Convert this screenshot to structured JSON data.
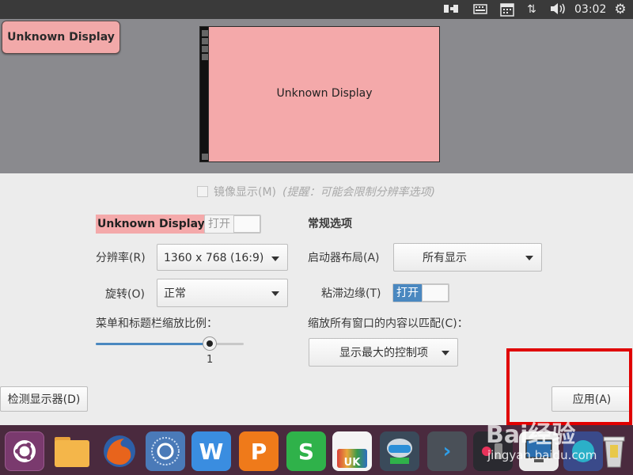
{
  "top_bar": {
    "clock": "03:02",
    "icons": [
      "display-icon",
      "keyboard-icon",
      "calendar-icon",
      "network-updown-icon",
      "volume-icon",
      "power-gear-icon"
    ]
  },
  "preview": {
    "badge_label": "Unknown Display",
    "monitor_label": "Unknown Display"
  },
  "settings": {
    "mirror_label": "镜像显示(M)",
    "mirror_hint": "(提醒：可能会限制分辨率选项)",
    "monitor_name": "Unknown Display",
    "monitor_switch_label": "打开",
    "resolution_label": "分辨率(R)",
    "resolution_value": "1360 x 768 (16:9)",
    "rotation_label": "旋转(O)",
    "rotation_value": "正常",
    "scale_label": "菜单和标题栏缩放比例：",
    "scale_value": "1",
    "general_heading": "常规选项",
    "launcher_label": "启动器布局(A)",
    "launcher_value": "所有显示",
    "sticky_label": "粘滞边缘(T)",
    "sticky_switch_label": "打开",
    "scale_windows_label": "缩放所有窗口的内容以匹配(C)：",
    "scale_windows_value": "显示最大的控制项",
    "detect_button": "检测显示器(D)",
    "apply_button": "应用(A)"
  },
  "scale_slider": {
    "fraction": 0.77
  },
  "dock": {
    "items": [
      "ubuntu-logo-icon",
      "files-icon",
      "firefox-icon",
      "browser-icon",
      "wps-writer-icon",
      "wps-presentation-icon",
      "wps-spreadsheet-icon",
      "ubuntu-software-icon",
      "remote-desktop-icon",
      "terminal-icon",
      "media-icon",
      "display-settings-icon",
      "app-icon",
      "trash-icon"
    ],
    "wps_letters": {
      "writer": "W",
      "presentation": "P",
      "spreadsheet": "S",
      "software": "UK"
    }
  },
  "watermark": {
    "brand": "Bai经验",
    "url": "jingyan.baidu.com"
  },
  "colors": {
    "display_pink": "#f4a9aa",
    "accent_blue": "#4a88c0",
    "highlight_red": "#e00000",
    "dock_bg": "#4a2a3e"
  }
}
